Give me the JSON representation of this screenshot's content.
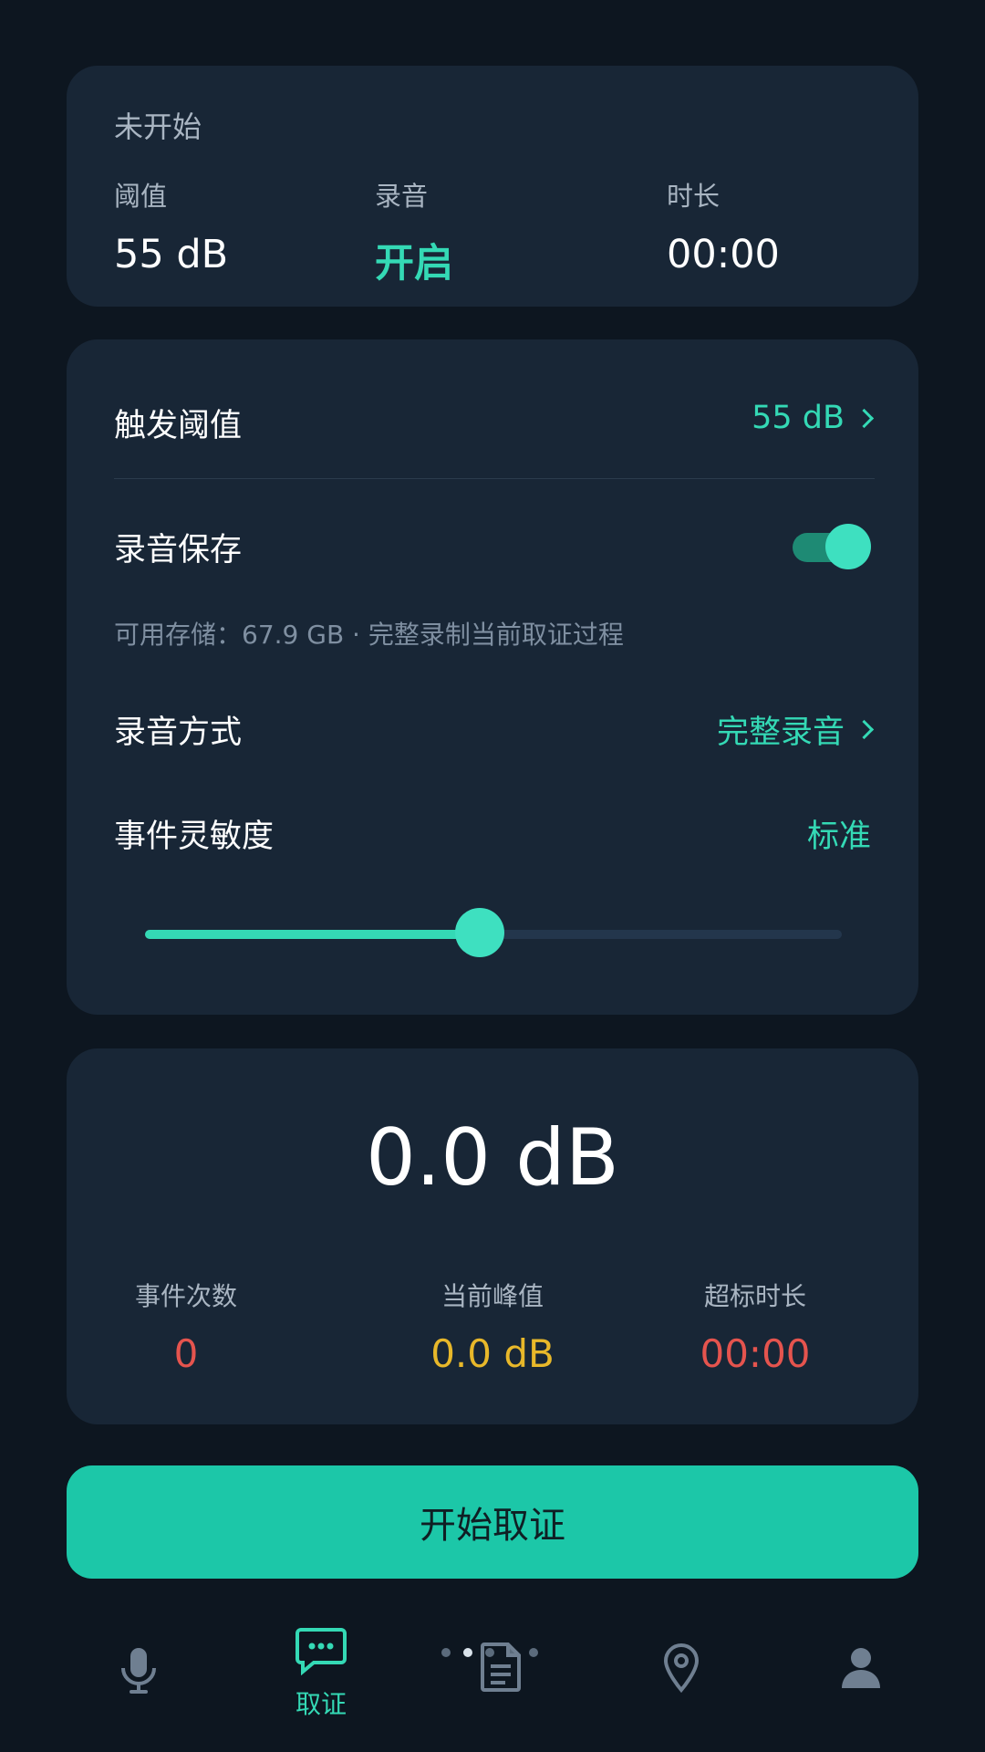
{
  "status": {
    "state": "未开始",
    "threshold_label": "阈值",
    "threshold_value": "55 dB",
    "recording_label": "录音",
    "recording_value": "开启",
    "duration_label": "时长",
    "duration_value": "00:00"
  },
  "settings": {
    "trigger_label": "触发阈值",
    "trigger_value": "55 dB",
    "save_label": "录音保存",
    "save_enabled": true,
    "storage_hint": "可用存储：67.9 GB · 完整录制当前取证过程",
    "mode_label": "录音方式",
    "mode_value": "完整录音",
    "sensitivity_label": "事件灵敏度",
    "sensitivity_value": "标准",
    "sensitivity_level": 0.48
  },
  "meter": {
    "current_value": "0.0 dB",
    "events_label": "事件次数",
    "events_value": "0",
    "peak_label": "当前峰值",
    "peak_value": "0.0 dB",
    "over_label": "超标时长",
    "over_value": "00:00"
  },
  "action": {
    "start_label": "开始取证"
  },
  "nav": {
    "active_label": "取证",
    "items": [
      "mic-icon",
      "message-icon",
      "document-icon",
      "location-icon",
      "person-icon"
    ]
  },
  "colors": {
    "accent": "#34d9b5",
    "button": "#1cc7a8",
    "peak": "#e8b82a",
    "alert": "#e5544e"
  }
}
